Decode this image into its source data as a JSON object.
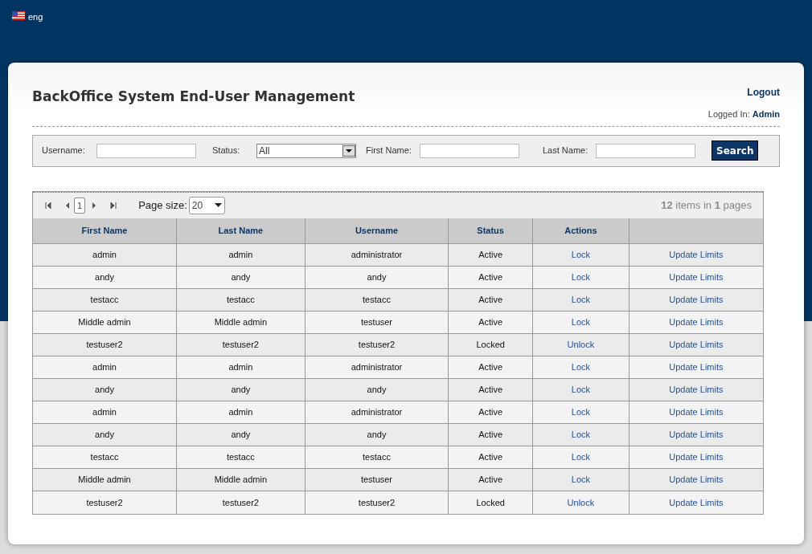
{
  "language": {
    "label": "eng"
  },
  "header": {
    "title": "BackOffice System End-User Management",
    "logout": "Logout",
    "logged_in_label": "Logged In:",
    "logged_in_user": "Admin"
  },
  "filters": {
    "username_label": "Username:",
    "status_label": "Status:",
    "status_value": "All",
    "first_name_label": "First Name:",
    "last_name_label": "Last Name:",
    "search_button": "Search"
  },
  "pager": {
    "current_page": "1",
    "page_size_label": "Page size:",
    "page_size": "20",
    "summary": "**12** items in **1** pages"
  },
  "table": {
    "columns": [
      "First Name",
      "Last Name",
      "Username",
      "Status",
      "Actions"
    ],
    "rows": [
      {
        "first_name": "admin",
        "last_name": "admin",
        "username": "administrator",
        "status": "Active",
        "action": "Lock",
        "limits": "Update Limits"
      },
      {
        "first_name": "andy",
        "last_name": "andy",
        "username": "andy",
        "status": "Active",
        "action": "Lock",
        "limits": "Update Limits"
      },
      {
        "first_name": "testacc",
        "last_name": "testacc",
        "username": "testacc",
        "status": "Active",
        "action": "Lock",
        "limits": "Update Limits"
      },
      {
        "first_name": "Middle admin",
        "last_name": "Middle admin",
        "username": "testuser",
        "status": "Active",
        "action": "Lock",
        "limits": "Update Limits"
      },
      {
        "first_name": "testuser2",
        "last_name": "testuser2",
        "username": "testuser2",
        "status": "Locked",
        "action": "Unlock",
        "limits": "Update Limits"
      },
      {
        "first_name": "admin",
        "last_name": "admin",
        "username": "administrator",
        "status": "Active",
        "action": "Lock",
        "limits": "Update Limits"
      },
      {
        "first_name": "andy",
        "last_name": "andy",
        "username": "andy",
        "status": "Active",
        "action": "Lock",
        "limits": "Update Limits"
      },
      {
        "first_name": "admin",
        "last_name": "admin",
        "username": "administrator",
        "status": "Active",
        "action": "Lock",
        "limits": "Update Limits"
      },
      {
        "first_name": "andy",
        "last_name": "andy",
        "username": "andy",
        "status": "Active",
        "action": "Lock",
        "limits": "Update Limits"
      },
      {
        "first_name": "testacc",
        "last_name": "testacc",
        "username": "testacc",
        "status": "Active",
        "action": "Lock",
        "limits": "Update Limits"
      },
      {
        "first_name": "Middle admin",
        "last_name": "Middle admin",
        "username": "testuser",
        "status": "Active",
        "action": "Lock",
        "limits": "Update Limits"
      },
      {
        "first_name": "testuser2",
        "last_name": "testuser2",
        "username": "testuser2",
        "status": "Locked",
        "action": "Unlock",
        "limits": "Update Limits"
      }
    ]
  }
}
